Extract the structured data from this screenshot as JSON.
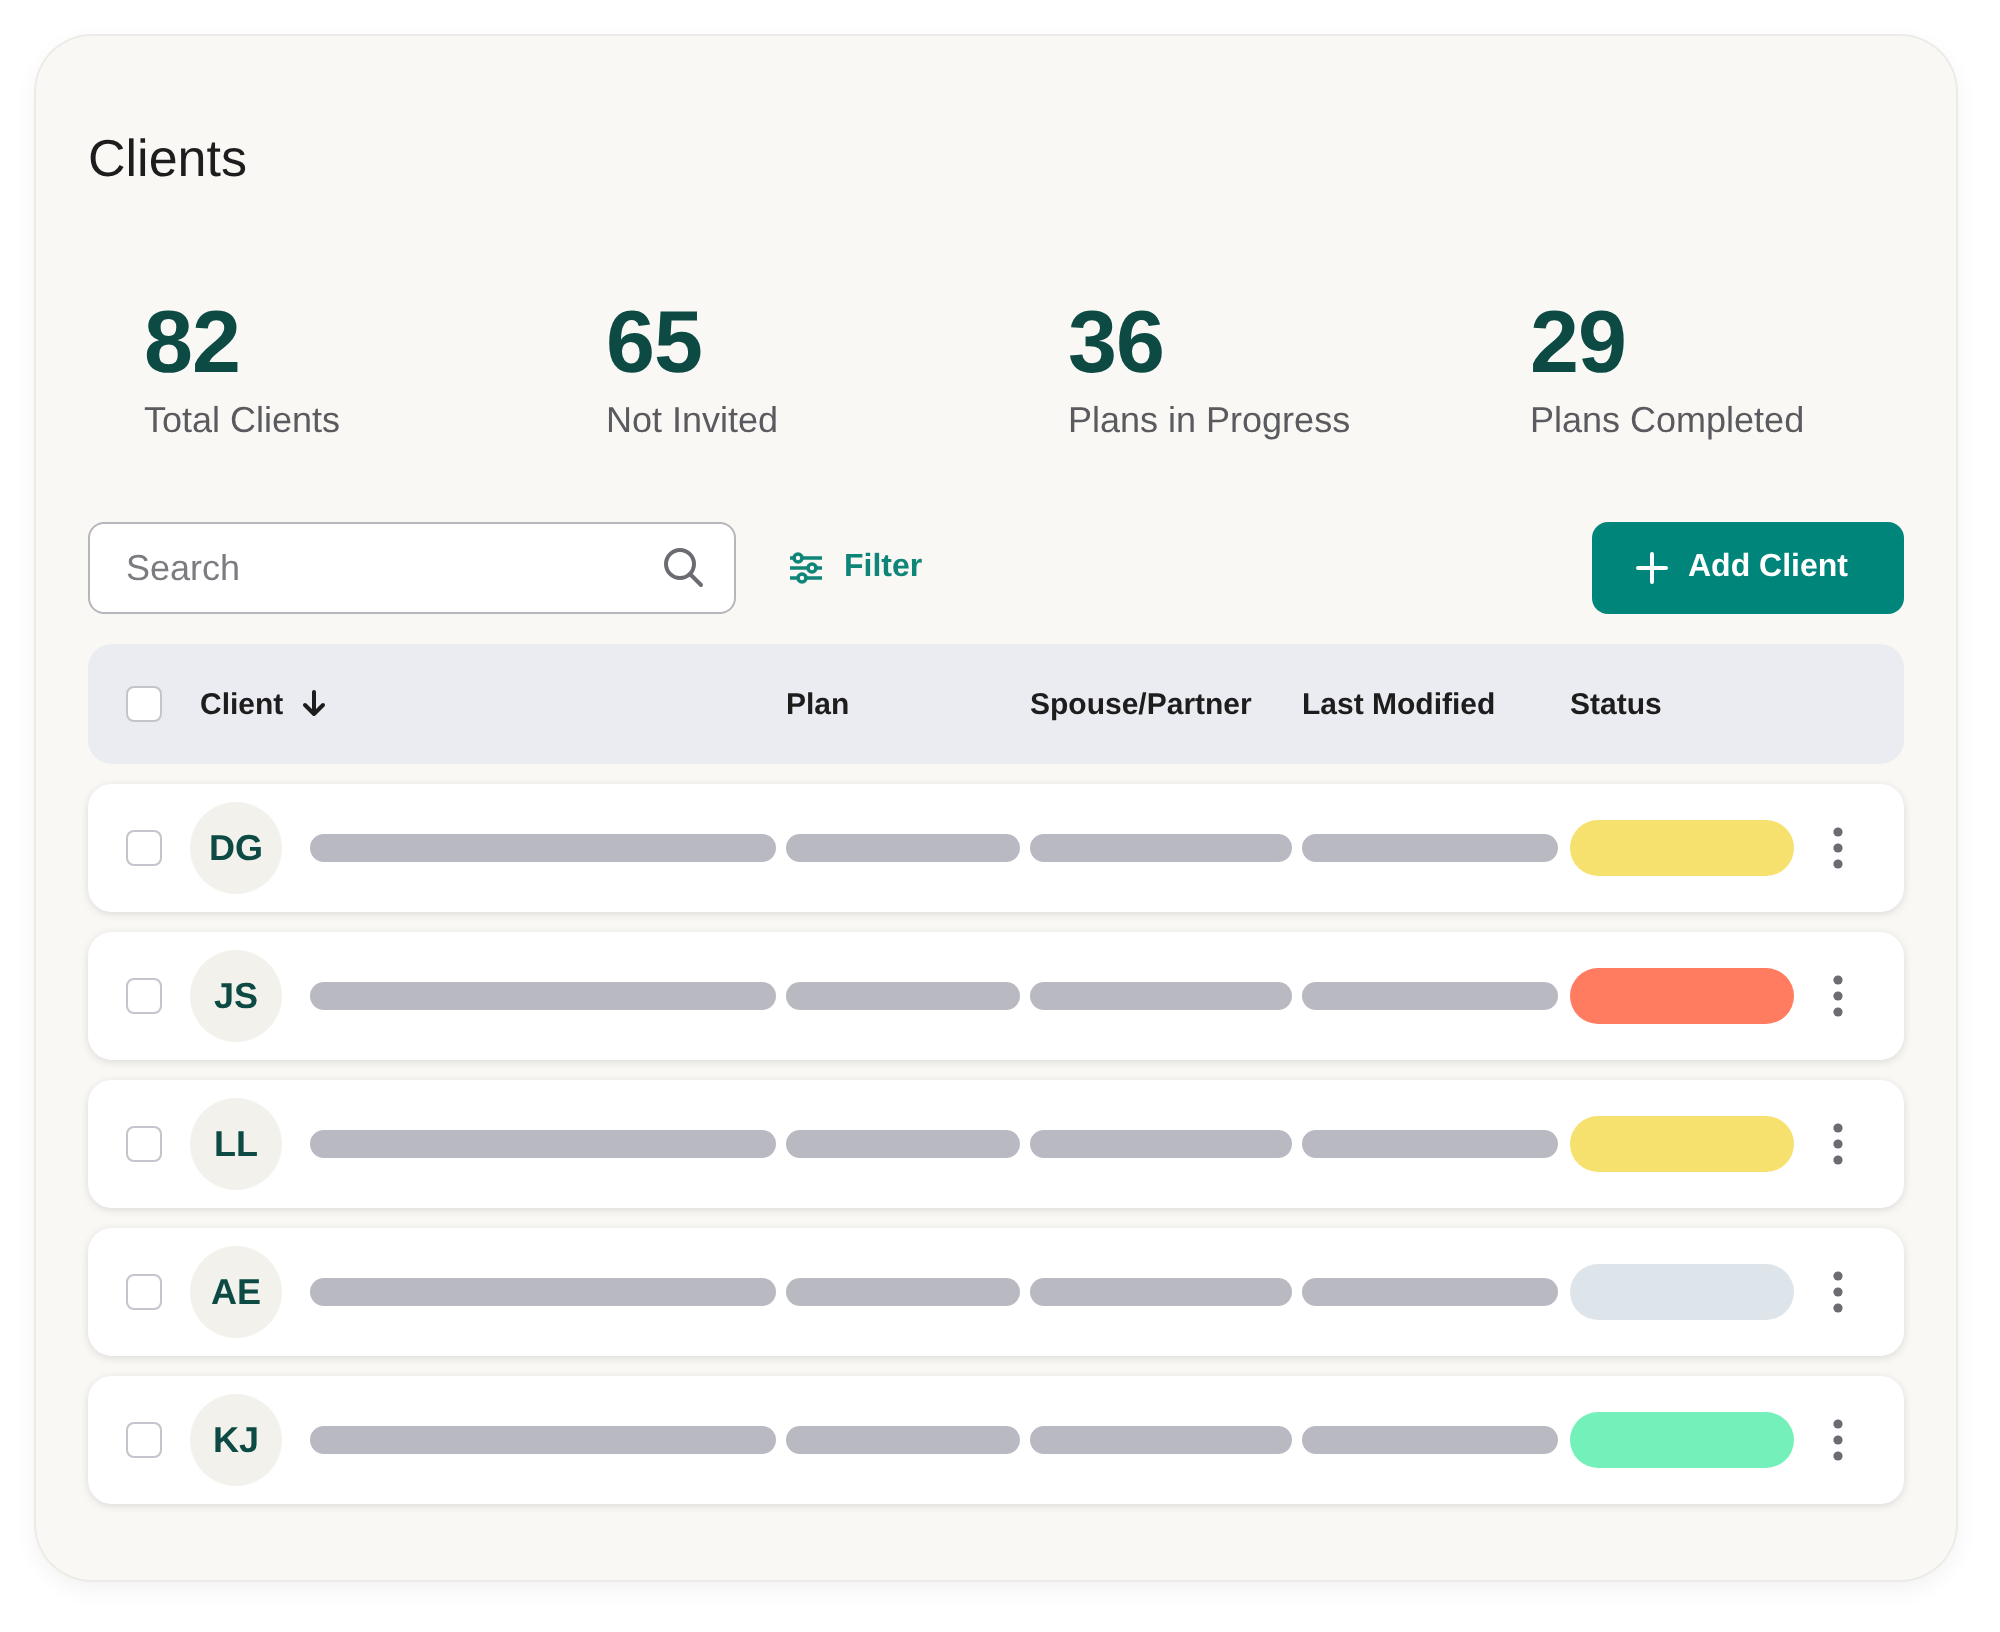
{
  "title": "Clients",
  "stats": [
    {
      "value": "82",
      "label": "Total Clients"
    },
    {
      "value": "65",
      "label": "Not Invited"
    },
    {
      "value": "36",
      "label": "Plans in Progress"
    },
    {
      "value": "29",
      "label": "Plans Completed"
    }
  ],
  "search": {
    "placeholder": "Search"
  },
  "filter_button": "Filter",
  "add_button": "Add Client",
  "table": {
    "select_all_checked": false,
    "columns": [
      {
        "label": "Client",
        "sorted": true
      },
      {
        "label": "Plan",
        "sorted": false
      },
      {
        "label": "Spouse/Partner",
        "sorted": false
      },
      {
        "label": "Last Modified",
        "sorted": false
      },
      {
        "label": "Status",
        "sorted": false
      }
    ],
    "rows": [
      {
        "initials": "DG",
        "checked": false,
        "color": "#f6e16f"
      },
      {
        "initials": "JS",
        "checked": false,
        "color": "#ff7c61"
      },
      {
        "initials": "LL",
        "checked": false,
        "color": "#f6e16f"
      },
      {
        "initials": "AE",
        "checked": false,
        "color": "#dde5ea"
      },
      {
        "initials": "KJ",
        "checked": false,
        "color": "#74f1ba"
      }
    ]
  }
}
